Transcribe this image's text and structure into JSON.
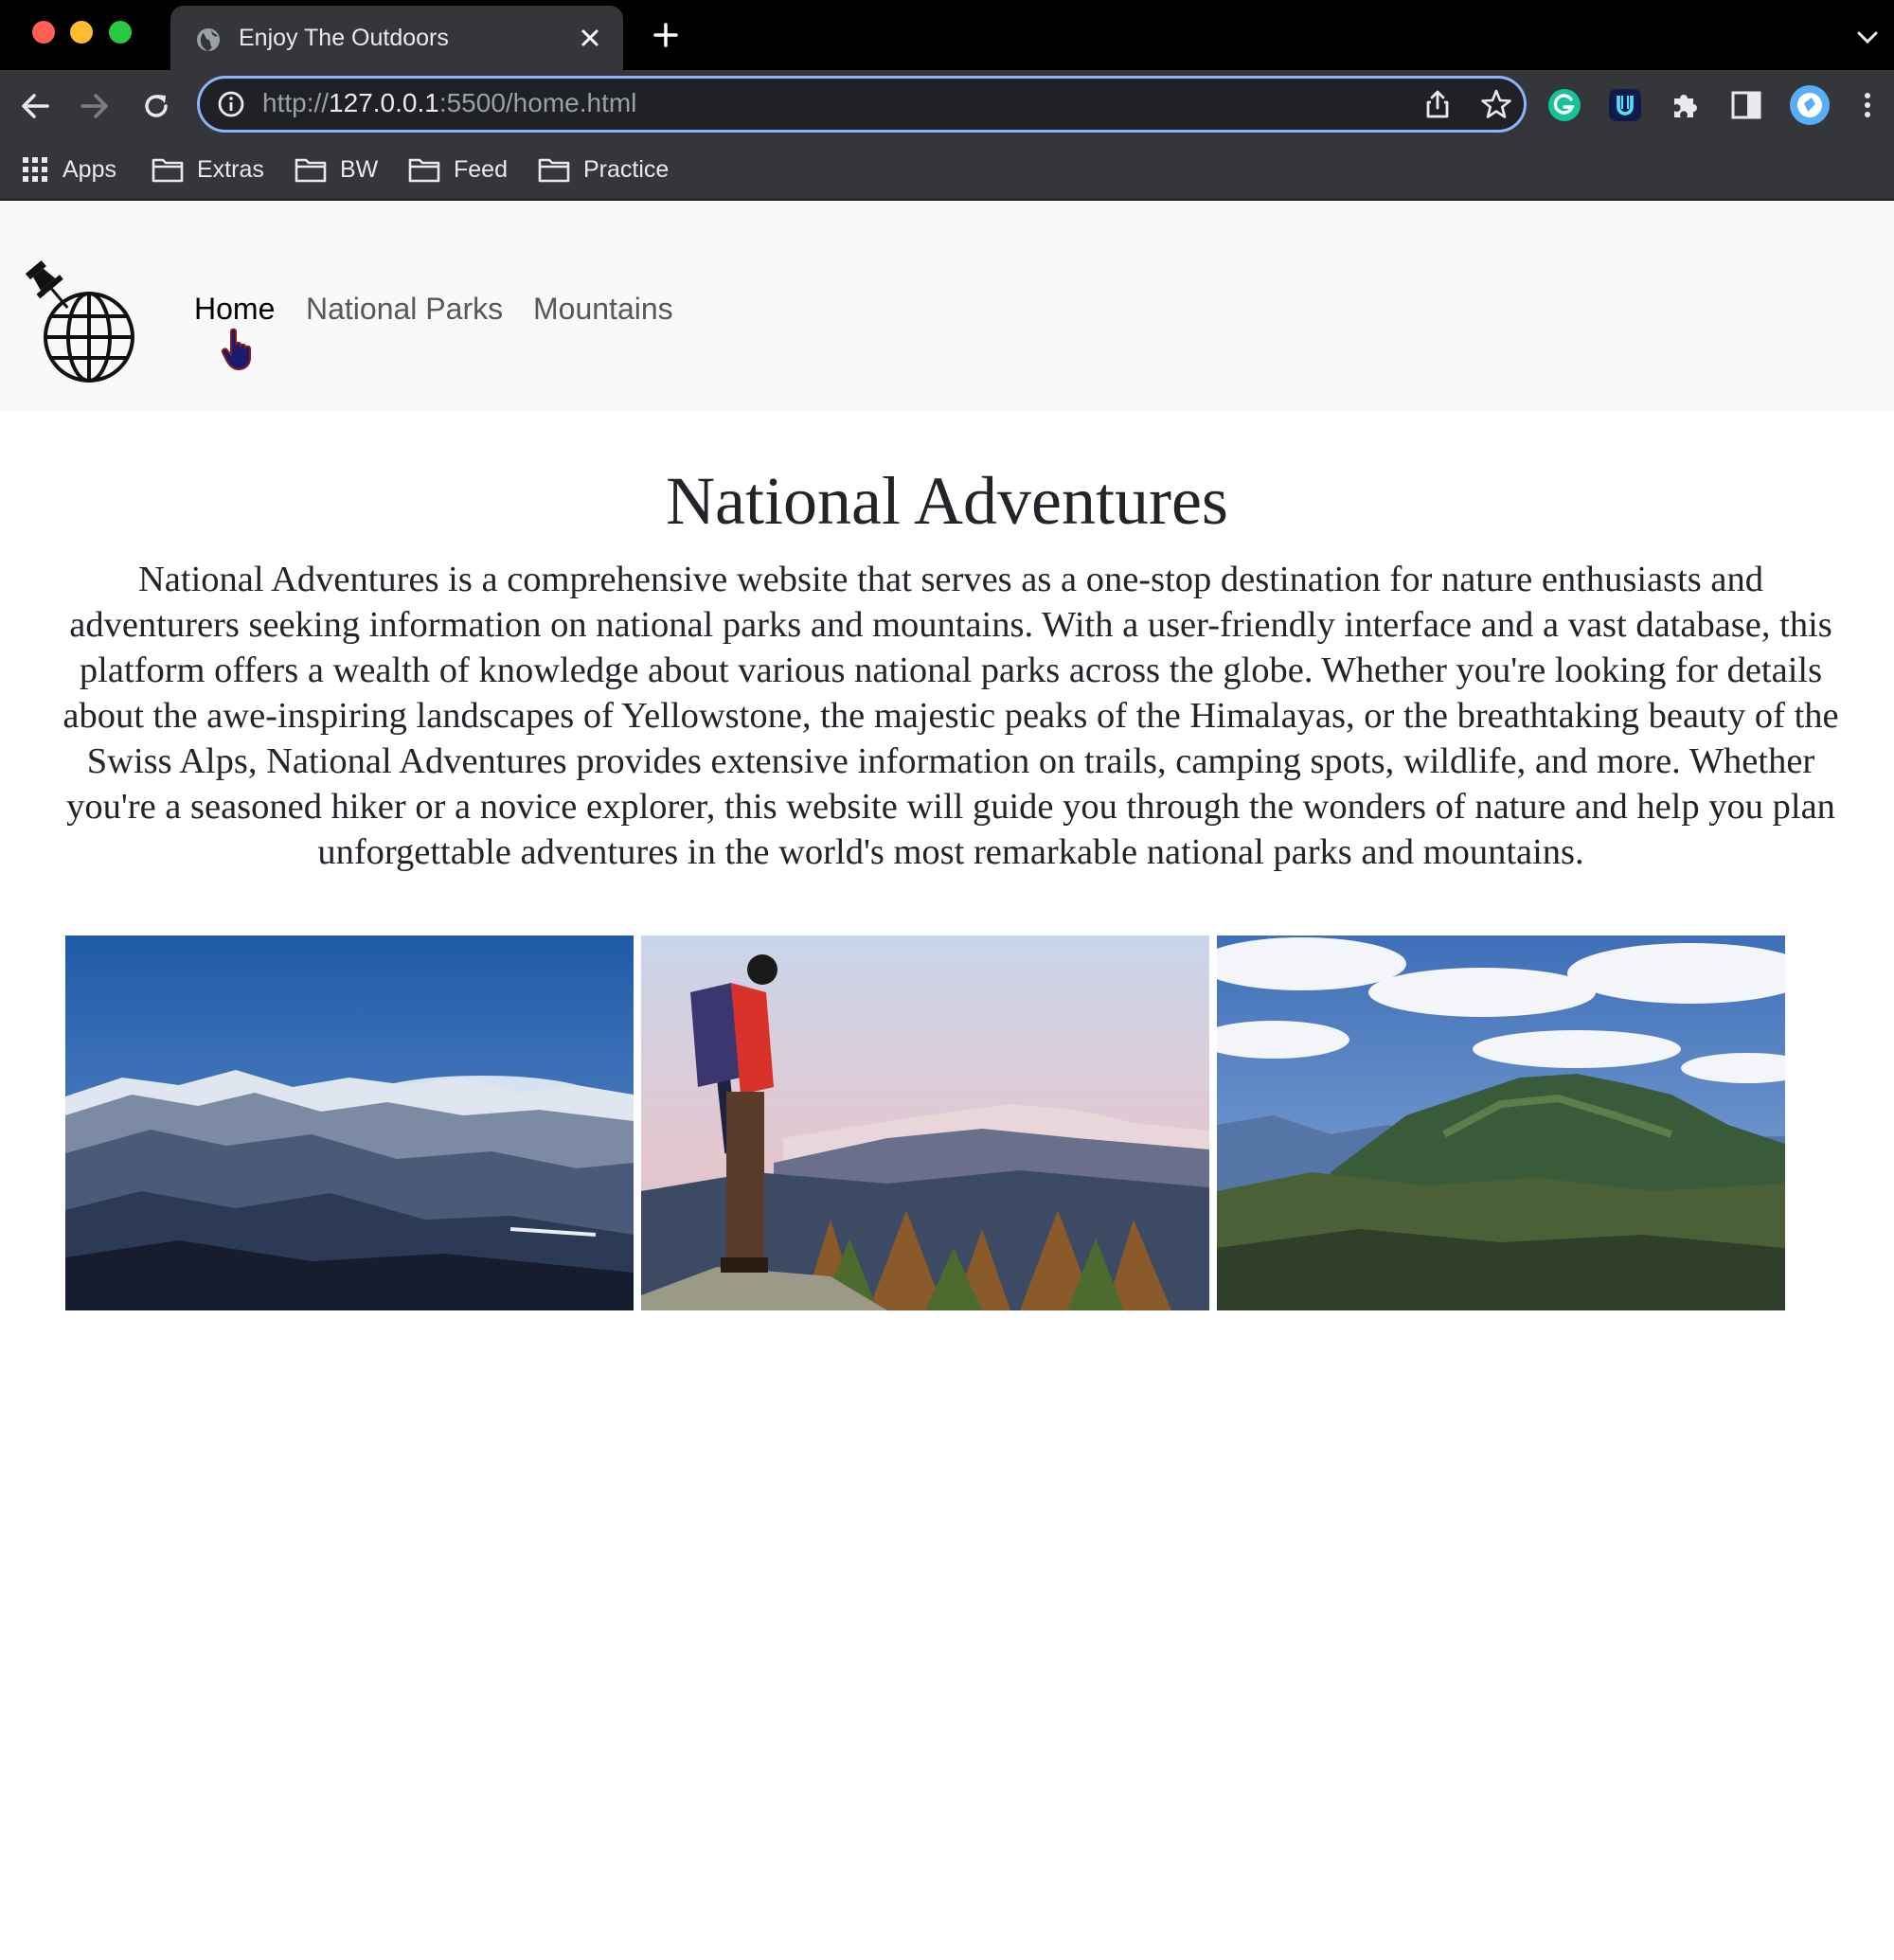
{
  "browser": {
    "tab_title": "Enjoy The Outdoors",
    "url_scheme": "http://",
    "url_host": "127.0.0.1",
    "url_rest": ":5500/home.html",
    "bookmarks": [
      {
        "label": "Apps",
        "icon": "apps-grid-icon"
      },
      {
        "label": "Extras",
        "icon": "folder-icon"
      },
      {
        "label": "BW",
        "icon": "folder-icon"
      },
      {
        "label": "Feed",
        "icon": "folder-icon"
      },
      {
        "label": "Practice",
        "icon": "folder-icon"
      }
    ],
    "extensions": [
      "grammarly-icon",
      "u-extension-icon",
      "extensions-puzzle-icon",
      "side-panel-icon",
      "profile-avatar-icon",
      "kebab-menu-icon"
    ]
  },
  "site": {
    "nav": {
      "links": [
        {
          "label": "Home",
          "state": "active"
        },
        {
          "label": "National Parks",
          "state": "inactive"
        },
        {
          "label": "Mountains",
          "state": "inactive"
        }
      ]
    },
    "title": "National Adventures",
    "intro": "National Adventures is a comprehensive website that serves as a one-stop destination for nature enthusiasts and adventurers seeking information on national parks and mountains. With a user-friendly interface and a vast database, this platform offers a wealth of knowledge about various national parks across the globe. Whether you're looking for details about the awe-inspiring landscapes of Yellowstone, the majestic peaks of the Himalayas, or the breathtaking beauty of the Swiss Alps, National Adventures provides extensive information on trails, camping spots, wildlife, and more. Whether you're a seasoned hiker or a novice explorer, this website will guide you through the wonders of nature and help you plan unforgettable adventures in the world's most remarkable national parks and mountains."
  },
  "colors": {
    "tab_bar": "#000000",
    "toolbar": "#35363a",
    "omnibox_focus": "#8ab4f8",
    "site_nav_bg": "#f8f9fa",
    "text": "#212529"
  }
}
